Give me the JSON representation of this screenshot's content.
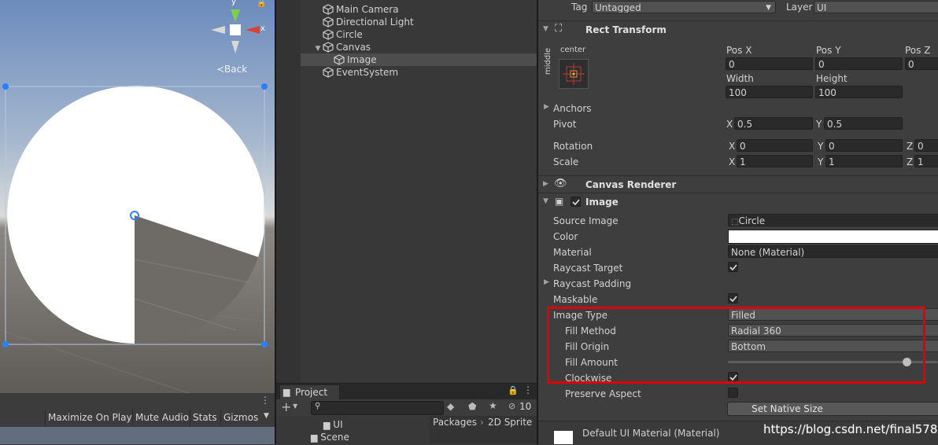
{
  "scene": {
    "back_label": "≺Back",
    "axis_y": "y",
    "axis_x": "x",
    "toolbar": [
      "Maximize On Play",
      "Mute Audio",
      "Stats",
      "Gizmos"
    ]
  },
  "hierarchy": {
    "items": [
      {
        "label": "Main Camera",
        "indent": 0
      },
      {
        "label": "Directional Light",
        "indent": 0
      },
      {
        "label": "Circle",
        "indent": 0
      },
      {
        "label": "Canvas",
        "indent": 0
      },
      {
        "label": "Image",
        "indent": 1
      },
      {
        "label": "EventSystem",
        "indent": 0
      }
    ],
    "selected": "Image"
  },
  "project": {
    "tab_label": "Project",
    "hidden_count": "10",
    "tree": [
      "UI",
      "Scene"
    ],
    "breadcrumb": [
      "Packages",
      "2D Sprite"
    ]
  },
  "inspector": {
    "tag_label": "Tag",
    "tag_value": "Untagged",
    "layer_label": "Layer",
    "layer_value": "UI",
    "rect_transform": {
      "title": "Rect Transform",
      "anchor_h": "center",
      "anchor_v": "middle",
      "pos_x_label": "Pos X",
      "pos_x": "0",
      "pos_y_label": "Pos Y",
      "pos_y": "0",
      "pos_z_label": "Pos Z",
      "pos_z": "0",
      "width_label": "Width",
      "width": "100",
      "height_label": "Height",
      "height": "100",
      "anchors_label": "Anchors",
      "pivot_label": "Pivot",
      "pivot_x": "0.5",
      "pivot_y": "0.5",
      "rotation_label": "Rotation",
      "rot_x": "0",
      "rot_y": "0",
      "rot_z": "0",
      "scale_label": "Scale",
      "scale_x": "1",
      "scale_y": "1",
      "scale_z": "1"
    },
    "canvas_renderer": {
      "title": "Canvas Renderer"
    },
    "image": {
      "title": "Image",
      "source_image_label": "Source Image",
      "source_image": "Circle",
      "color_label": "Color",
      "color_value": "#ffffff",
      "material_label": "Material",
      "material": "None (Material)",
      "raycast_target_label": "Raycast Target",
      "raycast_target": true,
      "raycast_padding_label": "Raycast Padding",
      "maskable_label": "Maskable",
      "maskable": true,
      "image_type_label": "Image Type",
      "image_type": "Filled",
      "fill_method_label": "Fill Method",
      "fill_method": "Radial 360",
      "fill_origin_label": "Fill Origin",
      "fill_origin": "Bottom",
      "fill_amount_label": "Fill Amount",
      "fill_amount": 0.85,
      "clockwise_label": "Clockwise",
      "clockwise": true,
      "preserve_aspect_label": "Preserve Aspect",
      "preserve_aspect": false,
      "set_native_size": "Set Native Size"
    },
    "material_preview": "Default UI Material (Material)"
  },
  "watermark": "https://blog.csdn.net/final5788",
  "colors": {
    "highlight": "#e00000",
    "selection": "#4d4d4d",
    "handle_blue": "#2a7fff"
  }
}
